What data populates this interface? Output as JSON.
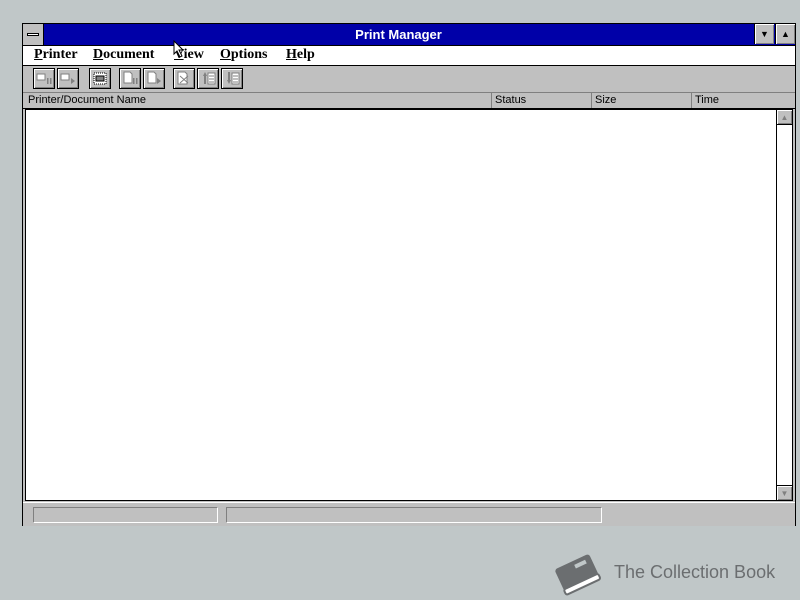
{
  "window": {
    "title": "Print Manager"
  },
  "titlebar": {
    "min_glyph": "▼",
    "max_glyph": "▲"
  },
  "menu": [
    {
      "label": "Printer",
      "mnemonic": "P",
      "rest": "rinter"
    },
    {
      "label": "Document",
      "mnemonic": "D",
      "rest": "ocument"
    },
    {
      "label": "View",
      "mnemonic": "V",
      "rest": "iew"
    },
    {
      "label": "Options",
      "mnemonic": "O",
      "rest": "ptions"
    },
    {
      "label": "Help",
      "mnemonic": "H",
      "rest": "elp"
    }
  ],
  "columns": [
    "Printer/Document Name",
    "Status",
    "Size",
    "Time"
  ],
  "documents": [],
  "scrollbar": {
    "up_glyph": "▲",
    "down_glyph": "▼"
  },
  "watermark": {
    "text": "The Collection Book"
  },
  "colors": {
    "titlebar": "#0000a8",
    "desktop": "#c0c7c8",
    "face": "#c0c0c0"
  }
}
